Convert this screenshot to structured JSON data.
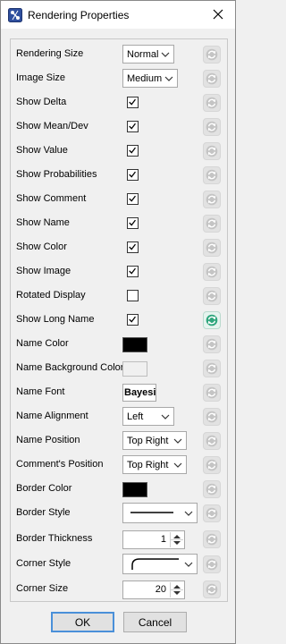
{
  "window": {
    "title": "Rendering Properties",
    "app_icon": "bayesia-app-icon",
    "close_icon": "close-icon"
  },
  "colors": {
    "accent": "#4a90d9",
    "reset_active": "#2fa67d",
    "reset_inactive": "#c4c4c4",
    "name_color": "#000000",
    "name_background_color": "#f0f0f0",
    "border_color": "#000000"
  },
  "rows": [
    {
      "id": "rendering_size",
      "label": "Rendering Size",
      "type": "combo",
      "value": "Normal"
    },
    {
      "id": "image_size",
      "label": "Image Size",
      "type": "combo",
      "value": "Medium"
    },
    {
      "id": "show_delta",
      "label": "Show Delta",
      "type": "checkbox",
      "checked": true
    },
    {
      "id": "show_mean_dev",
      "label": "Show Mean/Dev",
      "type": "checkbox",
      "checked": true
    },
    {
      "id": "show_value",
      "label": "Show Value",
      "type": "checkbox",
      "checked": true
    },
    {
      "id": "show_probabilities",
      "label": "Show Probabilities",
      "type": "checkbox",
      "checked": true
    },
    {
      "id": "show_comment",
      "label": "Show Comment",
      "type": "checkbox",
      "checked": true
    },
    {
      "id": "show_name",
      "label": "Show Name",
      "type": "checkbox",
      "checked": true
    },
    {
      "id": "show_color",
      "label": "Show Color",
      "type": "checkbox",
      "checked": true
    },
    {
      "id": "show_image",
      "label": "Show Image",
      "type": "checkbox",
      "checked": true
    },
    {
      "id": "rotated_display",
      "label": "Rotated Display",
      "type": "checkbox",
      "checked": false
    },
    {
      "id": "show_long_name",
      "label": "Show Long Name",
      "type": "checkbox",
      "checked": true,
      "reset_active": true
    },
    {
      "id": "name_color",
      "label": "Name Color",
      "type": "color"
    },
    {
      "id": "name_background_color",
      "label": "Name Background Color",
      "type": "color"
    },
    {
      "id": "name_font",
      "label": "Name Font",
      "type": "font",
      "value": "BayesiaLab"
    },
    {
      "id": "name_alignment",
      "label": "Name Alignment",
      "type": "combo",
      "value": "Left"
    },
    {
      "id": "name_position",
      "label": "Name Position",
      "type": "combo",
      "value": "Top Right"
    },
    {
      "id": "comments_position",
      "label": "Comment's Position",
      "type": "combo",
      "value": "Top Right"
    },
    {
      "id": "border_color",
      "label": "Border Color",
      "type": "color"
    },
    {
      "id": "border_style",
      "label": "Border Style",
      "type": "line-combo",
      "value": "solid-line"
    },
    {
      "id": "border_thickness",
      "label": "Border Thickness",
      "type": "spinner",
      "value": "1"
    },
    {
      "id": "corner_style",
      "label": "Corner Style",
      "type": "corner-combo",
      "value": "rounded-corner"
    },
    {
      "id": "corner_size",
      "label": "Corner Size",
      "type": "spinner",
      "value": "20"
    }
  ],
  "buttons": {
    "ok": "OK",
    "cancel": "Cancel"
  }
}
